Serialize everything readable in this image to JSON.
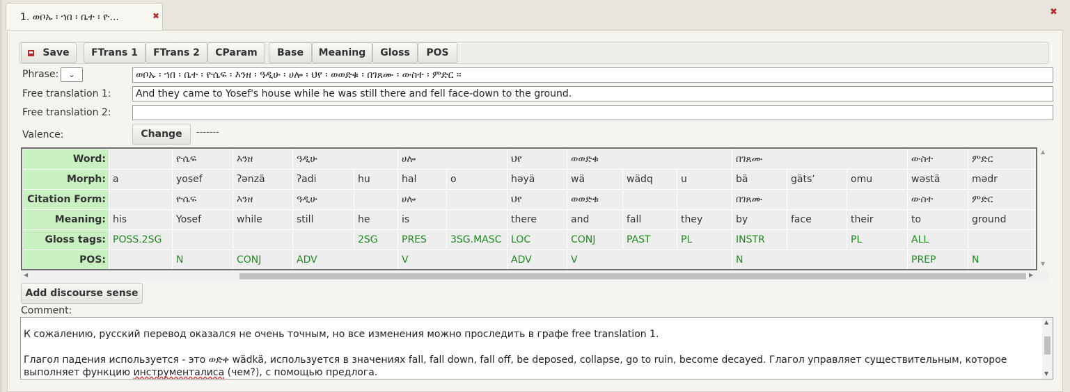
{
  "tab": {
    "title": "1. ወቦኡ ፡ ኀበ ፡ ቤተ ፡ ዮ...",
    "close": "✖"
  },
  "panel": {
    "close": "✖"
  },
  "toolbar": {
    "save_label": "Save",
    "tabs": [
      "FTrans 1",
      "FTrans 2",
      "CParam",
      "Base",
      "Meaning",
      "Gloss",
      "POS"
    ]
  },
  "labels": {
    "phrase": "Phrase:",
    "ft1": "Free translation 1:",
    "ft2": "Free translation 2:",
    "valence": "Valence:",
    "comment": "Comment:"
  },
  "phrase": {
    "select_value": "",
    "text": "ወቦኡ ፡ ኀበ ፡ ቤተ ፡ ዮሴፍ ፡ እንዘ ፡ ዓዲሁ ፡ ሀሎ ፡ ህየ ፡ ወወድቁ ፡ በገጸሙ ፡ ውስተ ፡ ምድር ።"
  },
  "free_translation_1": "And they came to Yosef's house while he was still there and fell face-down to the ground.",
  "free_translation_2": "",
  "valence": {
    "button": "Change",
    "value": "-------"
  },
  "grid": {
    "row_headers": [
      "Word:",
      "Morph:",
      "Citation Form:",
      "Meaning:",
      "Gloss tags:",
      "POS:"
    ],
    "words": [
      "",
      "ዮሴፍ",
      "እንዘ",
      "ዓዲሁ",
      "ሀሎ",
      "ህየ",
      "ወወድቁ",
      "በገጸሙ",
      "ውስተ",
      "ምድር"
    ],
    "morphs": [
      "a",
      "yosef",
      "ʔənzä",
      "ʔadi",
      "hu",
      "hal",
      "o",
      "həyä",
      "wä",
      "wädq",
      "u",
      "bä",
      "gätsʼ",
      "omu",
      "wəstä",
      "mədr"
    ],
    "citation": [
      "",
      "ዮሴፍ",
      "እንዘ",
      "ዓዲሁ",
      "",
      "ሀሎ",
      "",
      "ህየ",
      "ወወድቁ",
      "",
      "",
      "በገጸሙ",
      "",
      "",
      "ውስተ",
      "ምድር"
    ],
    "meaning": [
      "his",
      "Yosef",
      "while",
      "still",
      "he",
      "is",
      "",
      "there",
      "and",
      "fall",
      "they",
      "by",
      "face",
      "their",
      "to",
      "ground"
    ],
    "gloss": [
      "POSS.2SG",
      "",
      "",
      "",
      "2SG",
      "PRES",
      "3SG.MASC",
      "LOC",
      "CONJ",
      "PAST",
      "PL",
      "INSTR",
      "",
      "PL",
      "ALL",
      ""
    ],
    "pos": [
      "",
      "N",
      "CONJ",
      "ADV",
      "V",
      "ADV",
      "V",
      "N",
      "PREP",
      "N"
    ]
  },
  "add_discourse_label": "Add discourse sense",
  "comment": {
    "p1": "К сожалению, русский перевод оказался не очень точным, но все изменения можно проследить в графе free translation 1.",
    "p2_a": "Глагол падения используется - это ወድቀ wädkä, используется в значениях fall, fall down, fall off, be deposed, collapse, go to ruin, become decayed. Глагол управляет существительным, которое выполняет функцию ",
    "p2_b": "инструменталиса",
    "p2_c": " (чем?), с помощью предлога."
  },
  "icons": {
    "save": "save-icon",
    "close": "close-icon",
    "dropdown": "chevron-down-icon"
  }
}
